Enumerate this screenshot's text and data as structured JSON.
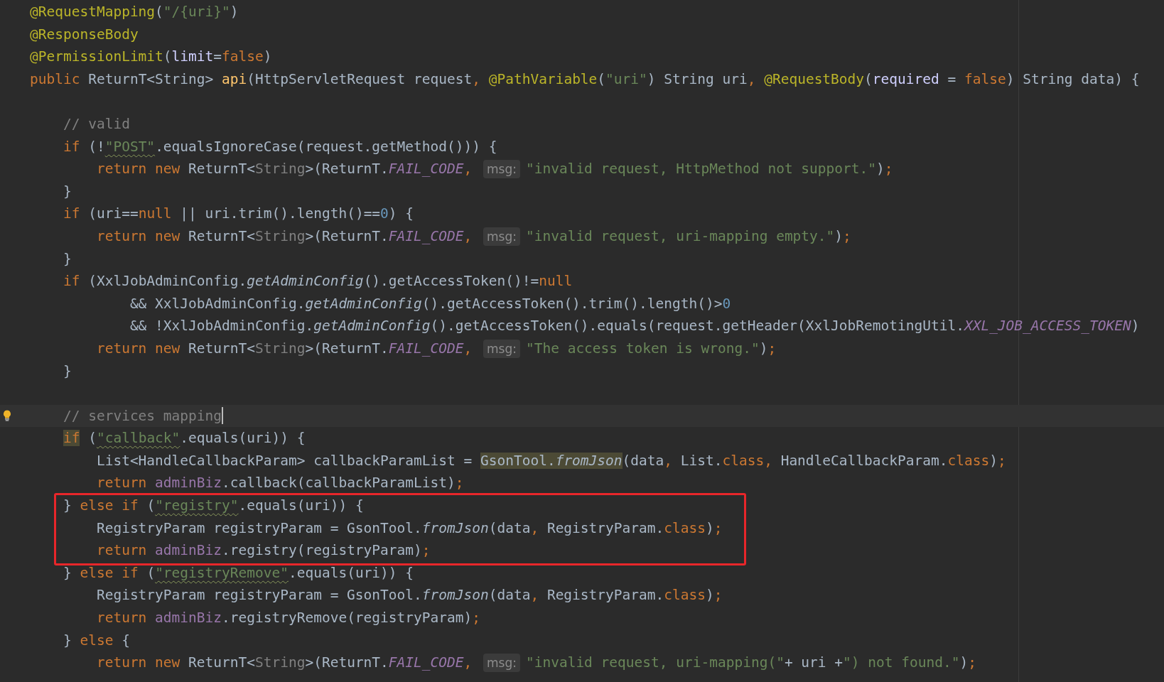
{
  "editor": {
    "blocks": [
      {
        "lines": [
          {
            "tokens": [
              {
                "text": "@RequestMapping",
                "kind": "annotation"
              },
              {
                "text": "(",
                "kind": "plain"
              },
              {
                "text": "\"/{uri}\"",
                "kind": "string"
              },
              {
                "text": ")",
                "kind": "plain"
              }
            ]
          },
          {
            "tokens": [
              {
                "text": "@ResponseBody",
                "kind": "annotation"
              }
            ]
          },
          {
            "tokens": [
              {
                "text": "@PermissionLimit",
                "kind": "annotation"
              },
              {
                "text": "(",
                "kind": "plain"
              },
              {
                "text": "limit",
                "kind": "named"
              },
              {
                "text": "=",
                "kind": "plain"
              },
              {
                "text": "false",
                "kind": "keyword"
              },
              {
                "text": ")",
                "kind": "plain"
              }
            ]
          },
          {
            "tokens": [
              {
                "text": "public ",
                "kind": "keyword"
              },
              {
                "text": "ReturnT<String> ",
                "kind": "plain"
              },
              {
                "text": "api",
                "kind": "method"
              },
              {
                "text": "(HttpServletRequest request",
                "kind": "plain"
              },
              {
                "text": ", ",
                "kind": "keyword"
              },
              {
                "text": "@PathVariable",
                "kind": "annotation"
              },
              {
                "text": "(",
                "kind": "plain"
              },
              {
                "text": "\"uri\"",
                "kind": "string"
              },
              {
                "text": ") String uri",
                "kind": "plain"
              },
              {
                "text": ", ",
                "kind": "keyword"
              },
              {
                "text": "@RequestBody",
                "kind": "annotation"
              },
              {
                "text": "(",
                "kind": "plain"
              },
              {
                "text": "required",
                "kind": "named"
              },
              {
                "text": " = ",
                "kind": "plain"
              },
              {
                "text": "false",
                "kind": "keyword"
              },
              {
                "text": ") String data) {",
                "kind": "plain"
              }
            ]
          }
        ]
      },
      {
        "lines": [
          {
            "tokens": [
              {
                "text": "    // valid",
                "kind": "comment"
              }
            ]
          },
          {
            "tokens": [
              {
                "text": "    if ",
                "kind": "keyword"
              },
              {
                "text": "(!",
                "kind": "plain"
              },
              {
                "text": "\"POST\"",
                "kind": "string",
                "warning": true
              },
              {
                "text": ".equalsIgnoreCase(request.getMethod())) {",
                "kind": "plain"
              }
            ]
          },
          {
            "tokens": [
              {
                "text": "        return new ",
                "kind": "keyword"
              },
              {
                "text": "ReturnT<",
                "kind": "plain"
              },
              {
                "text": "String",
                "kind": "redundant"
              },
              {
                "text": ">(ReturnT.",
                "kind": "plain"
              },
              {
                "text": "FAIL_CODE",
                "kind": "constant"
              },
              {
                "text": ", ",
                "kind": "keyword"
              },
              {
                "text": "msg:",
                "kind": "hint"
              },
              {
                "text": "\"invalid request, HttpMethod not support.\"",
                "kind": "string"
              },
              {
                "text": ")",
                "kind": "plain"
              },
              {
                "text": ";",
                "kind": "keyword"
              }
            ]
          },
          {
            "tokens": [
              {
                "text": "    }",
                "kind": "plain"
              }
            ]
          },
          {
            "tokens": [
              {
                "text": "    if ",
                "kind": "keyword"
              },
              {
                "text": "(uri==",
                "kind": "plain"
              },
              {
                "text": "null",
                "kind": "keyword"
              },
              {
                "text": " || uri.trim().length()==",
                "kind": "plain"
              },
              {
                "text": "0",
                "kind": "number"
              },
              {
                "text": ") {",
                "kind": "plain"
              }
            ]
          },
          {
            "tokens": [
              {
                "text": "        return new ",
                "kind": "keyword"
              },
              {
                "text": "ReturnT<",
                "kind": "plain"
              },
              {
                "text": "String",
                "kind": "redundant"
              },
              {
                "text": ">(ReturnT.",
                "kind": "plain"
              },
              {
                "text": "FAIL_CODE",
                "kind": "constant"
              },
              {
                "text": ", ",
                "kind": "keyword"
              },
              {
                "text": "msg:",
                "kind": "hint"
              },
              {
                "text": "\"invalid request, uri-mapping empty.\"",
                "kind": "string"
              },
              {
                "text": ")",
                "kind": "plain"
              },
              {
                "text": ";",
                "kind": "keyword"
              }
            ]
          },
          {
            "tokens": [
              {
                "text": "    }",
                "kind": "plain"
              }
            ]
          },
          {
            "tokens": [
              {
                "text": "    if ",
                "kind": "keyword"
              },
              {
                "text": "(XxlJobAdminConfig.",
                "kind": "plain"
              },
              {
                "text": "getAdminConfig",
                "kind": "static"
              },
              {
                "text": "().getAccessToken()!=",
                "kind": "plain"
              },
              {
                "text": "null",
                "kind": "keyword"
              }
            ]
          },
          {
            "tokens": [
              {
                "text": "            && XxlJobAdminConfig.",
                "kind": "plain"
              },
              {
                "text": "getAdminConfig",
                "kind": "static"
              },
              {
                "text": "().getAccessToken().trim().length()>",
                "kind": "plain"
              },
              {
                "text": "0",
                "kind": "number"
              }
            ]
          },
          {
            "tokens": [
              {
                "text": "            && !XxlJobAdminConfig.",
                "kind": "plain"
              },
              {
                "text": "getAdminConfig",
                "kind": "static"
              },
              {
                "text": "().getAccessToken().equals(request.getHeader(XxlJobRemotingUtil.",
                "kind": "plain"
              },
              {
                "text": "XXL_JOB_ACCESS_TOKEN",
                "kind": "constant"
              },
              {
                "text": ")",
                "kind": "plain"
              }
            ]
          },
          {
            "tokens": [
              {
                "text": "        return new ",
                "kind": "keyword"
              },
              {
                "text": "ReturnT<",
                "kind": "plain"
              },
              {
                "text": "String",
                "kind": "redundant"
              },
              {
                "text": ">(ReturnT.",
                "kind": "plain"
              },
              {
                "text": "FAIL_CODE",
                "kind": "constant"
              },
              {
                "text": ", ",
                "kind": "keyword"
              },
              {
                "text": "msg:",
                "kind": "hint"
              },
              {
                "text": "\"The access token is wrong.\"",
                "kind": "string"
              },
              {
                "text": ")",
                "kind": "plain"
              },
              {
                "text": ";",
                "kind": "keyword"
              }
            ]
          },
          {
            "tokens": [
              {
                "text": "    }",
                "kind": "plain"
              }
            ]
          }
        ]
      },
      {
        "lines": [
          {
            "current": true,
            "bulb": true,
            "tokens": [
              {
                "text": "    // services mapping",
                "kind": "comment"
              }
            ]
          },
          {
            "tokens": [
              {
                "text": "    if",
                "kind": "keyword",
                "highlighted": true
              },
              {
                "text": " (",
                "kind": "plain"
              },
              {
                "text": "\"callback\"",
                "kind": "string",
                "warning": true
              },
              {
                "text": ".equals(uri)) {",
                "kind": "plain"
              }
            ]
          },
          {
            "tokens": [
              {
                "text": "        List<HandleCallbackParam> callbackParamList = ",
                "kind": "plain"
              },
              {
                "text": "GsonTool.",
                "kind": "plain",
                "highlighted": true
              },
              {
                "text": "fromJson",
                "kind": "static",
                "highlighted": true
              },
              {
                "text": "(data",
                "kind": "plain"
              },
              {
                "text": ", ",
                "kind": "keyword"
              },
              {
                "text": "List.",
                "kind": "plain"
              },
              {
                "text": "class",
                "kind": "keyword"
              },
              {
                "text": ", ",
                "kind": "keyword"
              },
              {
                "text": "HandleCallbackParam.",
                "kind": "plain"
              },
              {
                "text": "class",
                "kind": "keyword"
              },
              {
                "text": ")",
                "kind": "plain"
              },
              {
                "text": ";",
                "kind": "keyword"
              }
            ]
          },
          {
            "tokens": [
              {
                "text": "        return ",
                "kind": "keyword"
              },
              {
                "text": "adminBiz",
                "kind": "field"
              },
              {
                "text": ".callback(callbackParamList)",
                "kind": "plain"
              },
              {
                "text": ";",
                "kind": "keyword"
              }
            ]
          },
          {
            "boxed": true,
            "tokens": [
              {
                "text": "    } ",
                "kind": "plain"
              },
              {
                "text": "else if ",
                "kind": "keyword"
              },
              {
                "text": "(",
                "kind": "plain"
              },
              {
                "text": "\"registry\"",
                "kind": "string",
                "warning": true
              },
              {
                "text": ".equals(uri)) {",
                "kind": "plain"
              }
            ]
          },
          {
            "boxed": true,
            "tokens": [
              {
                "text": "        RegistryParam registryParam = GsonTool.",
                "kind": "plain"
              },
              {
                "text": "fromJson",
                "kind": "static"
              },
              {
                "text": "(data",
                "kind": "plain"
              },
              {
                "text": ", ",
                "kind": "keyword"
              },
              {
                "text": "RegistryParam.",
                "kind": "plain"
              },
              {
                "text": "class",
                "kind": "keyword"
              },
              {
                "text": ")",
                "kind": "plain"
              },
              {
                "text": ";",
                "kind": "keyword"
              }
            ]
          },
          {
            "boxed": true,
            "tokens": [
              {
                "text": "        return ",
                "kind": "keyword"
              },
              {
                "text": "adminBiz",
                "kind": "field"
              },
              {
                "text": ".registry(registryParam)",
                "kind": "plain"
              },
              {
                "text": ";",
                "kind": "keyword"
              }
            ]
          },
          {
            "tokens": [
              {
                "text": "    } ",
                "kind": "plain"
              },
              {
                "text": "else if ",
                "kind": "keyword"
              },
              {
                "text": "(",
                "kind": "plain"
              },
              {
                "text": "\"registryRemove\"",
                "kind": "string",
                "warning": true
              },
              {
                "text": ".equals(uri)) {",
                "kind": "plain"
              }
            ]
          },
          {
            "tokens": [
              {
                "text": "        RegistryParam registryParam = GsonTool.",
                "kind": "plain"
              },
              {
                "text": "fromJson",
                "kind": "static"
              },
              {
                "text": "(data",
                "kind": "plain"
              },
              {
                "text": ", ",
                "kind": "keyword"
              },
              {
                "text": "RegistryParam.",
                "kind": "plain"
              },
              {
                "text": "class",
                "kind": "keyword"
              },
              {
                "text": ")",
                "kind": "plain"
              },
              {
                "text": ";",
                "kind": "keyword"
              }
            ]
          },
          {
            "tokens": [
              {
                "text": "        return ",
                "kind": "keyword"
              },
              {
                "text": "adminBiz",
                "kind": "field"
              },
              {
                "text": ".registryRemove(registryParam)",
                "kind": "plain"
              },
              {
                "text": ";",
                "kind": "keyword"
              }
            ]
          },
          {
            "tokens": [
              {
                "text": "    } ",
                "kind": "plain"
              },
              {
                "text": "else ",
                "kind": "keyword"
              },
              {
                "text": "{",
                "kind": "plain"
              }
            ]
          },
          {
            "tokens": [
              {
                "text": "        return new ",
                "kind": "keyword"
              },
              {
                "text": "ReturnT<",
                "kind": "plain"
              },
              {
                "text": "String",
                "kind": "redundant"
              },
              {
                "text": ">(ReturnT.",
                "kind": "plain"
              },
              {
                "text": "FAIL_CODE",
                "kind": "constant"
              },
              {
                "text": ", ",
                "kind": "keyword"
              },
              {
                "text": "msg:",
                "kind": "hint"
              },
              {
                "text": "\"invalid request, uri-mapping(\"",
                "kind": "string"
              },
              {
                "text": "+ uri +",
                "kind": "plain"
              },
              {
                "text": "\") not found.\"",
                "kind": "string"
              },
              {
                "text": ")",
                "kind": "plain"
              },
              {
                "text": ";",
                "kind": "keyword"
              }
            ]
          }
        ]
      }
    ]
  }
}
